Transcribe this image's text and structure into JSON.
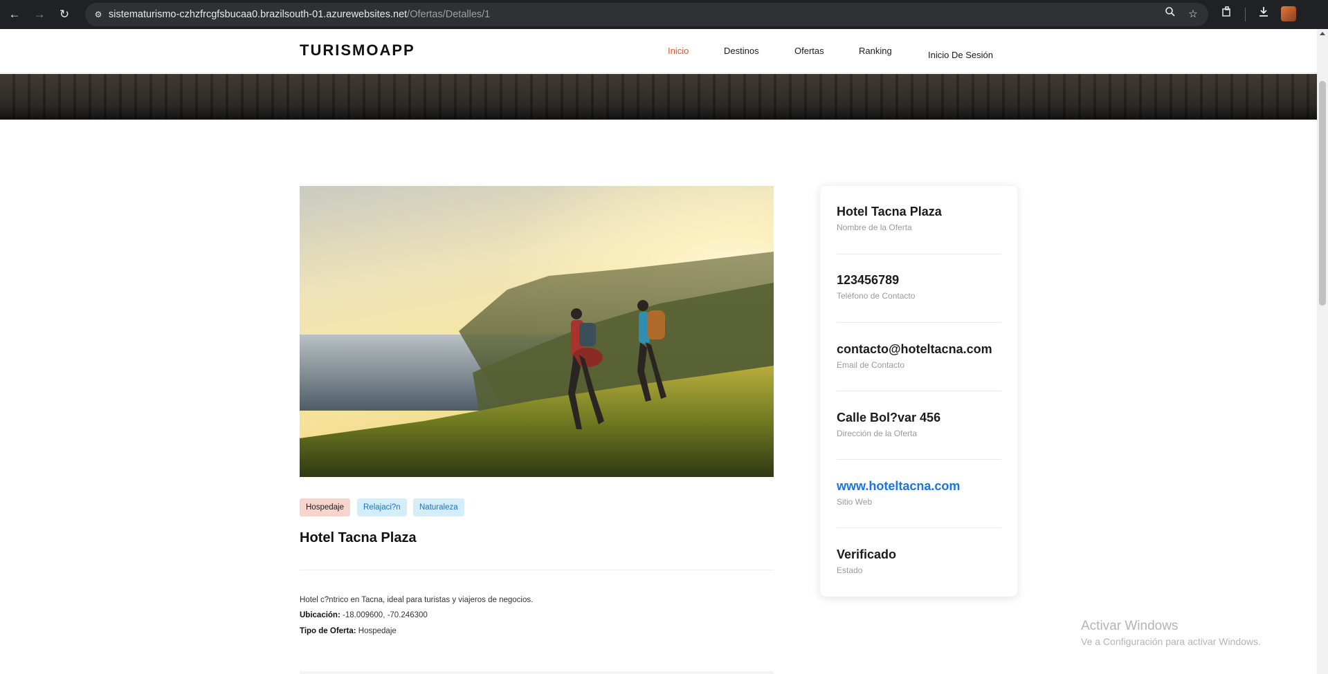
{
  "browser": {
    "url_host": "sistematurismo-czhzfrcgfsbucaa0.brazilsouth-01.azurewebsites.net",
    "url_path": "/Ofertas/Detalles/1",
    "icons": [
      "back-arrow-icon",
      "forward-arrow-icon",
      "reload-icon",
      "site-info-icon",
      "zoom-icon",
      "star-icon",
      "extensions-icon",
      "download-icon"
    ]
  },
  "navbar": {
    "brand": "TURISMOAPP",
    "links": [
      {
        "label": "Inicio",
        "active": true
      },
      {
        "label": "Destinos",
        "active": false
      },
      {
        "label": "Ofertas",
        "active": false
      },
      {
        "label": "Ranking",
        "active": false
      },
      {
        "label": "Inicio De Sesión",
        "active": false
      }
    ],
    "accent_color": "#e2552f"
  },
  "offer": {
    "tags": [
      "Hospedaje",
      "Relajaci?n",
      "Naturaleza"
    ],
    "title": "Hotel Tacna Plaza",
    "description": "Hotel c?ntrico en Tacna, ideal para turistas y viajeros de negocios.",
    "location_label": "Ubicación:",
    "location_value": "-18.009600, -70.246300",
    "type_label": "Tipo de Oferta:",
    "type_value": "Hospedaje"
  },
  "sidebar": {
    "items": [
      {
        "value": "Hotel Tacna Plaza",
        "label": "Nombre de la Oferta"
      },
      {
        "value": "123456789",
        "label": "Teléfono de Contacto"
      },
      {
        "value": "contacto@hoteltacna.com",
        "label": "Email de Contacto"
      },
      {
        "value": "Calle Bol?var 456",
        "label": "Dirección de la Oferta"
      },
      {
        "value": "www.hoteltacna.com",
        "label": "Sitio Web"
      },
      {
        "value": "Verificado",
        "label": "Estado"
      }
    ]
  },
  "watermark": {
    "title": "Activar Windows",
    "subtitle": "Ve a Configuración para activar Windows."
  }
}
